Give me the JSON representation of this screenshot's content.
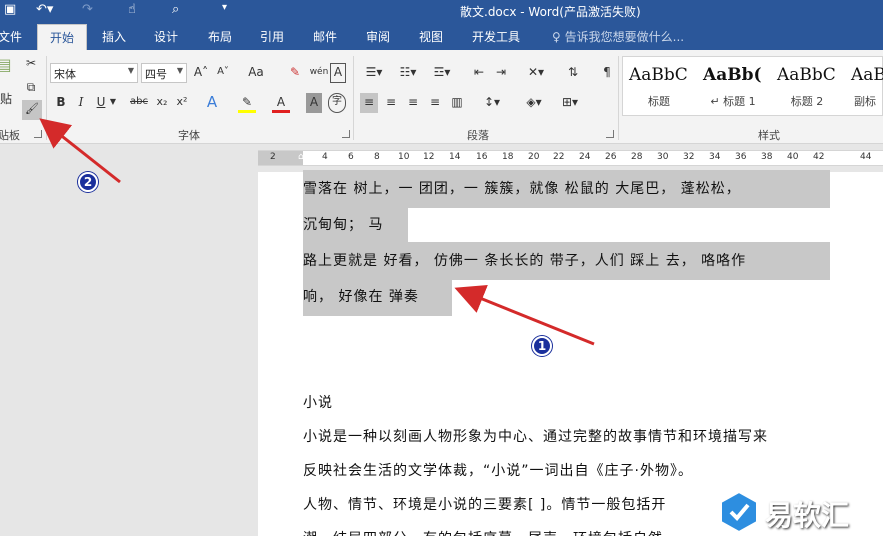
{
  "window": {
    "title": "散文.docx - Word(产品激活失败)"
  },
  "tabs": [
    {
      "label": "文件"
    },
    {
      "label": "开始"
    },
    {
      "label": "插入"
    },
    {
      "label": "设计"
    },
    {
      "label": "布局"
    },
    {
      "label": "引用"
    },
    {
      "label": "邮件"
    },
    {
      "label": "审阅"
    },
    {
      "label": "视图"
    },
    {
      "label": "开发工具"
    }
  ],
  "active_tab": "开始",
  "tell_me": {
    "placeholder": "告诉我您想要做什么..."
  },
  "ribbon": {
    "clipboard": {
      "paste_label": "贴",
      "group_label": "贴板"
    },
    "font": {
      "font_name": "宋体",
      "font_size": "四号",
      "group_label": "字体",
      "buttons": {
        "bold": "B",
        "italic": "I",
        "underline": "U",
        "strike": "abc",
        "subscript": "x₂",
        "superscript": "x²",
        "grow": "A˄",
        "shrink": "A˅",
        "case": "Aa",
        "phonetic": "wén",
        "border_char": "A",
        "effect": "A",
        "font_color": "A",
        "shading": "A",
        "enclose": "字"
      }
    },
    "paragraph": {
      "group_label": "段落"
    },
    "styles": {
      "group_label": "样式",
      "items": [
        {
          "sample": "AaBbC",
          "name": "标题"
        },
        {
          "sample": "AaBb(",
          "name": "↵ 标题 1"
        },
        {
          "sample": "AaBbC",
          "name": "标题 2"
        },
        {
          "sample": "AaBl",
          "name": "副标"
        }
      ]
    }
  },
  "ruler": {
    "ticks": [
      "2",
      "2",
      "4",
      "6",
      "8",
      "10",
      "12",
      "14",
      "16",
      "18",
      "20",
      "22",
      "24",
      "26",
      "28",
      "30",
      "32",
      "34",
      "36",
      "38",
      "40",
      "42",
      "44"
    ]
  },
  "document": {
    "lines": [
      {
        "text": "雪落在 树上，一 团团，一 簇簇，就像 松鼠的 大尾巴， 蓬松松，",
        "highlight": true
      },
      {
        "text": "沉甸甸； 马",
        "highlight": true
      },
      {
        "text": "路上更就是 好看， 仿佛一 条长长的 带子，人们 踩上 去， 咯咯作",
        "highlight": true
      },
      {
        "text": "响， 好像在 弹奏",
        "highlight": true
      },
      {
        "text": "",
        "highlight": false
      },
      {
        "text": "小说",
        "highlight": false
      },
      {
        "text": "小说是一种以刻画人物形象为中心、通过完整的故事情节和环境描写来",
        "highlight": false
      },
      {
        "text": "反映社会生活的文学体裁，“小说”一词出自《庄子·外物》。",
        "highlight": false
      },
      {
        "text": "人物、情节、环境是小说的三要素[ ]。情节一般包括开",
        "highlight": false
      },
      {
        "text": "潮、结局四部分，有的包括序幕、尾声。环境包括自然",
        "highlight": false
      }
    ]
  },
  "annotations": {
    "badge_1": "1",
    "badge_2": "2"
  },
  "watermark": {
    "text": "易软汇"
  },
  "colors": {
    "accent": "#2b579a",
    "highlight": "#c8c8c8",
    "arrow": "#d42a2a",
    "badge": "#1a2f9c"
  }
}
